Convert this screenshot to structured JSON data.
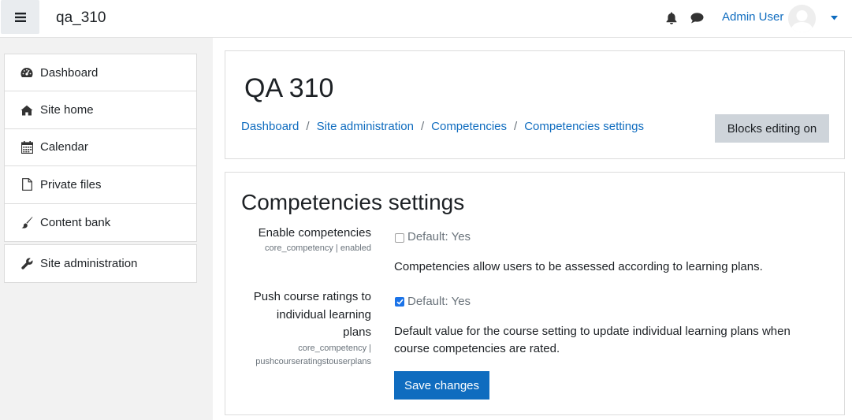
{
  "navbar": {
    "menu_icon": "hamburger-icon",
    "site_name": "qa_310",
    "notification_icon": "bell-icon",
    "messages_icon": "chat-bubble-icon",
    "user_name": "Admin User",
    "user_menu_icon": "caret-down-icon"
  },
  "sidebar": {
    "items": [
      {
        "label": "Dashboard",
        "icon": "dashboard-icon"
      },
      {
        "label": "Site home",
        "icon": "home-icon"
      },
      {
        "label": "Calendar",
        "icon": "calendar-icon"
      },
      {
        "label": "Private files",
        "icon": "file-icon"
      },
      {
        "label": "Content bank",
        "icon": "paintbrush-icon"
      }
    ],
    "admin": {
      "label": "Site administration",
      "icon": "wrench-icon"
    }
  },
  "header": {
    "title": "QA 310",
    "breadcrumb": [
      "Dashboard",
      "Site administration",
      "Competencies",
      "Competencies settings"
    ],
    "separator": "/",
    "blocks_button": "Blocks editing on"
  },
  "settings": {
    "title": "Competencies settings",
    "items": [
      {
        "label": "Enable competencies",
        "key": "core_competency | enabled",
        "checked": false,
        "default": "Default: Yes",
        "description": "Competencies allow users to be assessed according to learning plans."
      },
      {
        "label_lines": [
          "Push course ratings to",
          "individual learning",
          "plans"
        ],
        "key_lines": [
          "core_competency |",
          "pushcourseratingstouserplans"
        ],
        "checked": true,
        "default": "Default: Yes",
        "description_lines": [
          "Default value for the course setting to update individual learning plans when",
          "course competencies are rated."
        ]
      }
    ],
    "save_button": "Save changes"
  },
  "colors": {
    "link": "#0f6cbf",
    "primary_button": "#0f6cbf",
    "secondary_button": "#ced4da",
    "checkbox_checked": "#1b73e8"
  }
}
